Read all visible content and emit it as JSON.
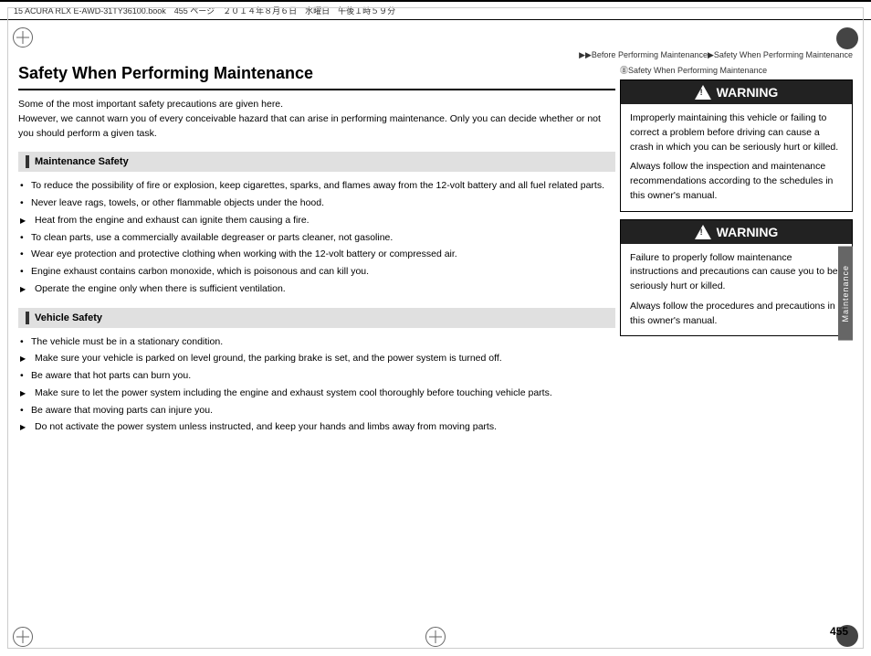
{
  "page": {
    "number": "455",
    "top_bar_text": "15 ACURA RLX E-AWD-31TY36100.book　455 ページ　２０１４年８月６日　水曜日　午後１時５９分"
  },
  "breadcrumb": {
    "text": "▶▶Before Performing Maintenance▶Safety When Performing Maintenance"
  },
  "main": {
    "title": "Safety When Performing Maintenance",
    "intro": [
      "Some of the most important safety precautions are given here.",
      "However, we cannot warn you of every conceivable hazard that can arise in performing maintenance. Only you can decide whether or not you should perform a given task."
    ],
    "sections": [
      {
        "id": "maintenance-safety",
        "heading": "Maintenance Safety",
        "items": [
          {
            "type": "bullet",
            "text": "To reduce the possibility of fire or explosion, keep cigarettes, sparks, and flames away from the 12-volt battery and all fuel related parts."
          },
          {
            "type": "bullet",
            "text": "Never leave rags, towels, or other flammable objects under the hood."
          },
          {
            "type": "arrow",
            "text": "Heat from the engine and exhaust can ignite them causing a fire."
          },
          {
            "type": "bullet",
            "text": "To clean parts, use a commercially available degreaser or parts cleaner, not gasoline."
          },
          {
            "type": "bullet",
            "text": "Wear eye protection and protective clothing when working with the 12-volt battery or compressed air."
          },
          {
            "type": "bullet",
            "text": "Engine exhaust contains carbon monoxide, which is poisonous and can kill you."
          },
          {
            "type": "arrow",
            "text": "Operate the engine only when there is sufficient ventilation."
          }
        ]
      },
      {
        "id": "vehicle-safety",
        "heading": "Vehicle Safety",
        "items": [
          {
            "type": "bullet",
            "text": "The vehicle must be in a stationary condition."
          },
          {
            "type": "arrow",
            "text": "Make sure your vehicle is parked on level ground, the parking brake is set, and the power system is turned off."
          },
          {
            "type": "bullet",
            "text": "Be aware that hot parts can burn you."
          },
          {
            "type": "arrow",
            "text": "Make sure to let the power system including the engine and exhaust system cool thoroughly before touching vehicle parts."
          },
          {
            "type": "bullet",
            "text": "Be aware that moving parts can injure you."
          },
          {
            "type": "arrow",
            "text": "Do not activate the power system unless instructed, and keep your hands and limbs away from moving parts."
          }
        ]
      }
    ]
  },
  "sidebar": {
    "ref_text": "⓼Safety When Performing Maintenance",
    "warnings": [
      {
        "id": "warning-1",
        "header": "WARNING",
        "body_paragraphs": [
          "Improperly maintaining this vehicle or failing to correct a problem before driving can cause a crash in which you can be seriously hurt or killed.",
          "Always follow the inspection and maintenance recommendations according to the schedules in this owner's manual."
        ]
      },
      {
        "id": "warning-2",
        "header": "WARNING",
        "body_paragraphs": [
          "Failure to properly follow maintenance instructions and precautions can cause you to be seriously hurt or killed.",
          "Always follow the procedures and precautions in this owner's manual."
        ]
      }
    ],
    "tab_label": "Maintenance"
  }
}
